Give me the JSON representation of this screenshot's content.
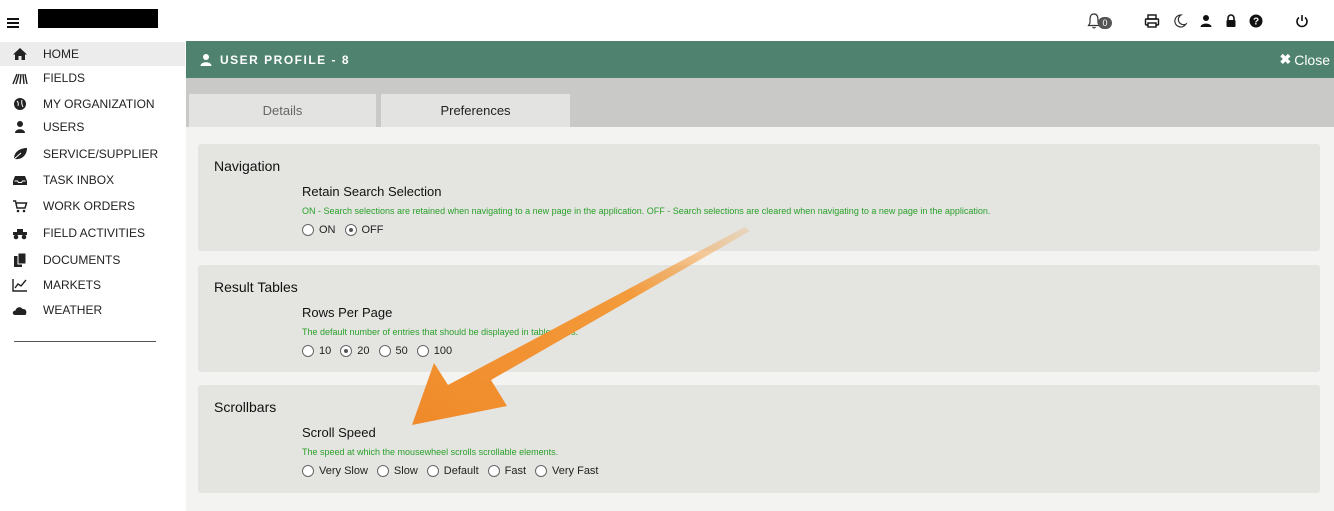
{
  "notifications": {
    "count": "0"
  },
  "sidebar": {
    "items": [
      {
        "label": "HOME",
        "icon": "home-icon"
      },
      {
        "label": "FIELDS",
        "icon": "fields-icon"
      },
      {
        "label": "MY ORGANIZATION",
        "icon": "globe-icon"
      },
      {
        "label": "USERS",
        "icon": "user-icon"
      },
      {
        "label": "SERVICE/SUPPLIER",
        "icon": "leaf-icon"
      },
      {
        "label": "TASK INBOX",
        "icon": "inbox-icon"
      },
      {
        "label": "WORK ORDERS",
        "icon": "cart-icon"
      },
      {
        "label": "FIELD ACTIVITIES",
        "icon": "tractor-icon"
      },
      {
        "label": "DOCUMENTS",
        "icon": "documents-icon"
      },
      {
        "label": "MARKETS",
        "icon": "chart-line-icon"
      },
      {
        "label": "WEATHER",
        "icon": "cloud-icon"
      }
    ]
  },
  "panel": {
    "title": "USER PROFILE - 8",
    "close_label": "Close",
    "tabs": [
      {
        "label": "Details"
      },
      {
        "label": "Preferences"
      }
    ]
  },
  "sections": {
    "navigation": {
      "title": "Navigation",
      "setting": "Retain Search Selection",
      "description": "ON - Search selections are retained when navigating to a new page in the application. OFF - Search selections are cleared when navigating to a new page in the application.",
      "options": [
        "ON",
        "OFF"
      ],
      "selected": "OFF"
    },
    "result_tables": {
      "title": "Result Tables",
      "setting": "Rows Per Page",
      "description": "The default number of entries that should be displayed in table views.",
      "options": [
        "10",
        "20",
        "50",
        "100"
      ],
      "selected": "20"
    },
    "scrollbars": {
      "title": "Scrollbars",
      "setting": "Scroll Speed",
      "description": "The speed at which the mousewheel scrolls scrollable elements.",
      "options": [
        "Very Slow",
        "Slow",
        "Default",
        "Fast",
        "Very Fast"
      ],
      "selected": ""
    }
  },
  "colors": {
    "header": "#4f8370",
    "description_text": "#2aa12a",
    "annotation_arrow": "#f08a2a"
  }
}
